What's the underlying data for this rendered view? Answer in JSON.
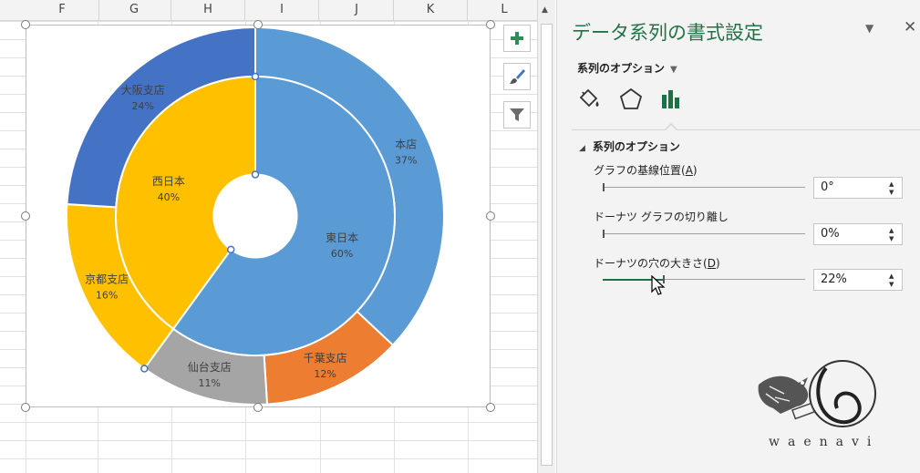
{
  "sheet": {
    "columns": [
      "F",
      "G",
      "H",
      "I",
      "J",
      "K",
      "L"
    ]
  },
  "chart_toolbar": {
    "add_element_icon": "plus-icon",
    "style_icon": "paintbrush-icon",
    "filter_icon": "funnel-icon"
  },
  "chart_data": {
    "type": "donut",
    "hole_size_percent": 22,
    "rings": [
      {
        "ring": "inner",
        "labels": [
          "東日本",
          "西日本"
        ],
        "values": [
          60,
          40
        ],
        "value_labels": [
          "60%",
          "40%"
        ],
        "colors": [
          "#5b9bd5",
          "#ffc000"
        ]
      },
      {
        "ring": "outer",
        "labels": [
          "本店",
          "千葉支店",
          "仙台支店",
          "京都支店",
          "大阪支店"
        ],
        "values": [
          37,
          12,
          11,
          16,
          24
        ],
        "value_labels": [
          "37%",
          "12%",
          "11%",
          "16%",
          "24%"
        ],
        "colors": [
          "#5b9bd5",
          "#ed7d31",
          "#a5a5a5",
          "#ffc000",
          "#4472c4"
        ]
      }
    ]
  },
  "pane": {
    "title": "データ系列の書式設定",
    "options_dropdown": "系列のオプション",
    "tabs": [
      "fill-line-icon",
      "effects-pentagon-icon",
      "series-options-bar-icon"
    ],
    "section_title": "系列のオプション",
    "options": [
      {
        "label": "グラフの基線位置(",
        "key": "A",
        "suffix": ")",
        "value": "0°",
        "slider_fraction": 0.0
      },
      {
        "label": "ドーナツ グラフの切り離し",
        "key": "",
        "suffix": "",
        "value": "0%",
        "slider_fraction": 0.0
      },
      {
        "label": "ドーナツの穴の大きさ(",
        "key": "D",
        "suffix": ")",
        "value": "22%",
        "slider_fraction": 0.22
      }
    ]
  },
  "watermark": {
    "text": "waenavi"
  },
  "colors": {
    "accent_green": "#217346"
  }
}
